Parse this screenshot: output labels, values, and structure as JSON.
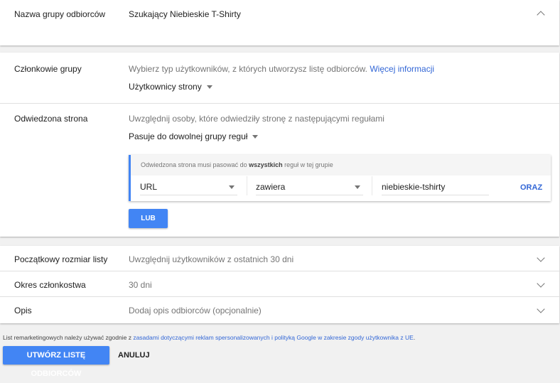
{
  "audience_name": {
    "label": "Nazwa grupy odbiorców",
    "value": "Szukający Niebieskie T-Shirty"
  },
  "members": {
    "label": "Członkowie grupy",
    "description": "Wybierz typ użytkowników, z których utworzysz listę odbiorców.",
    "link": "Więcej informacji",
    "dropdown": "Użytkownicy strony"
  },
  "visited_page": {
    "label": "Odwiedzona strona",
    "description": "Uwzględnij osoby, które odwiedziły stronę z następującymi regułami",
    "dropdown": "Pasuje do dowolnej grupy reguł",
    "rule_group": {
      "header_prefix": "Odwiedzona strona musi pasować do",
      "header_bold": "wszystkich",
      "header_suffix": "reguł w tej grupie",
      "field": "URL",
      "operator": "zawiera",
      "value": "niebieskie-tshirty",
      "and_button": "ORAZ"
    },
    "or_button": "LUB"
  },
  "initial_size": {
    "label": "Początkowy rozmiar listy",
    "value": "Uwzględnij użytkowników z ostatnich 30 dni"
  },
  "membership": {
    "label": "Okres członkostwa",
    "value": "30 dni"
  },
  "description": {
    "label": "Opis",
    "placeholder": "Dodaj opis odbiorców (opcjonalnie)"
  },
  "footer": {
    "note_prefix": "List remarketingowych należy używać zgodnie z",
    "note_link": "zasadami dotyczącymi reklam spersonalizowanych i polityką Google w zakresie zgody użytkownika z UE",
    "note_suffix": ".",
    "create_button": "UTWÓRZ LISTĘ ODBIORCÓW",
    "cancel_button": "ANULUJ"
  },
  "colors": {
    "accent": "#4285f4",
    "link": "#3367d6"
  }
}
